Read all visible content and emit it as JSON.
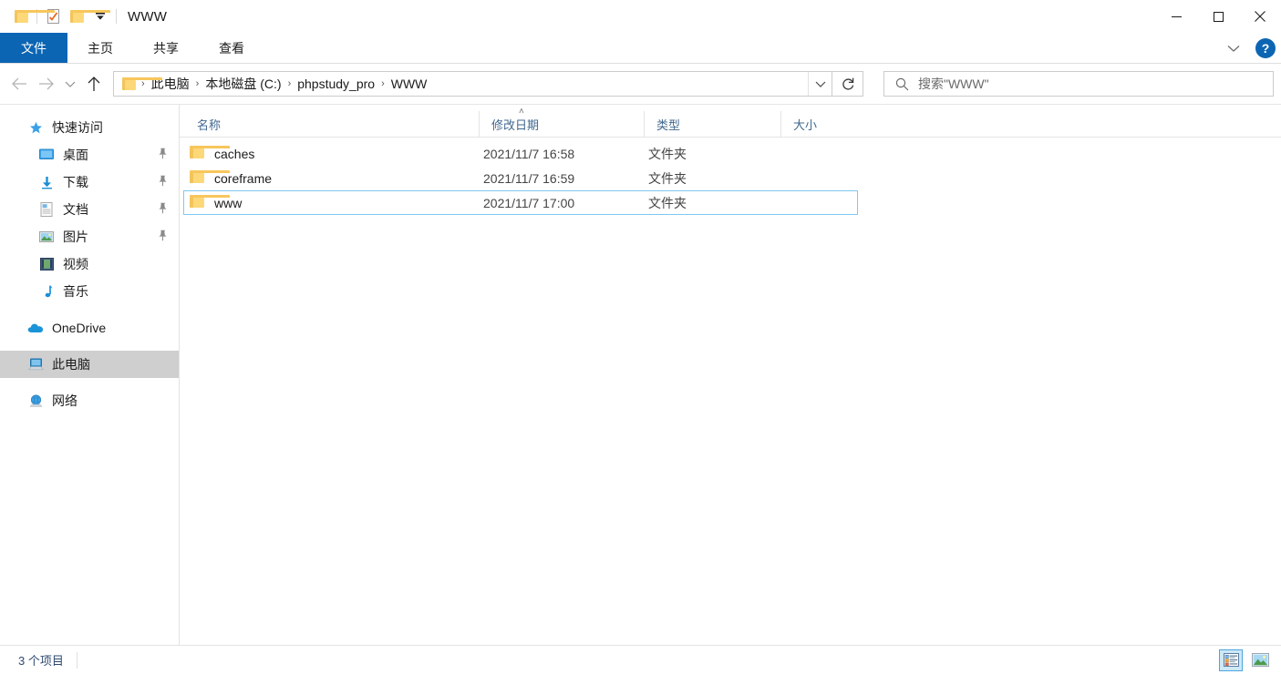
{
  "window": {
    "title": "WWW",
    "controls": {
      "minimize": "—",
      "maximize": "□",
      "close": "✕"
    }
  },
  "quick_access_toolbar": {
    "items": [
      {
        "name": "folder-icon",
        "label": ""
      },
      {
        "name": "properties-icon",
        "label": ""
      },
      {
        "name": "new-folder-icon",
        "label": ""
      },
      {
        "name": "customize-dropdown-icon",
        "label": "⯆"
      }
    ]
  },
  "ribbon": {
    "tabs": [
      {
        "label": "文件",
        "active": true
      },
      {
        "label": "主页",
        "active": false
      },
      {
        "label": "共享",
        "active": false
      },
      {
        "label": "查看",
        "active": false
      }
    ],
    "expand_icon": "⌄",
    "help_label": "?"
  },
  "navigation": {
    "back_icon": "←",
    "forward_icon": "→",
    "recent_icon": "⌄",
    "up_icon": "↑",
    "breadcrumbs": [
      "此电脑",
      "本地磁盘 (C:)",
      "phpstudy_pro",
      "WWW"
    ],
    "separator": "›",
    "dropdown_icon": "⌄",
    "refresh_icon": "↻"
  },
  "search": {
    "placeholder": "搜索\"WWW\"",
    "value": "",
    "icon": "search-icon"
  },
  "sidebar": {
    "items": [
      {
        "label": "快速访问",
        "icon": "star-icon",
        "level": 0,
        "pinned": false,
        "selected": false
      },
      {
        "label": "桌面",
        "icon": "desktop-icon",
        "level": 1,
        "pinned": true,
        "selected": false
      },
      {
        "label": "下载",
        "icon": "downloads-icon",
        "level": 1,
        "pinned": true,
        "selected": false
      },
      {
        "label": "文档",
        "icon": "documents-icon",
        "level": 1,
        "pinned": true,
        "selected": false
      },
      {
        "label": "图片",
        "icon": "pictures-icon",
        "level": 1,
        "pinned": true,
        "selected": false
      },
      {
        "label": "视频",
        "icon": "videos-icon",
        "level": 1,
        "pinned": false,
        "selected": false
      },
      {
        "label": "音乐",
        "icon": "music-icon",
        "level": 1,
        "pinned": false,
        "selected": false
      },
      {
        "label": "OneDrive",
        "icon": "cloud-icon",
        "level": 0,
        "pinned": false,
        "selected": false
      },
      {
        "label": "此电脑",
        "icon": "this-pc-icon",
        "level": 0,
        "pinned": false,
        "selected": true
      },
      {
        "label": "网络",
        "icon": "network-icon",
        "level": 0,
        "pinned": false,
        "selected": false
      }
    ],
    "pin_glyph": "📌"
  },
  "filelist": {
    "columns": [
      {
        "label": "名称",
        "key": "name"
      },
      {
        "label": "修改日期",
        "key": "date"
      },
      {
        "label": "类型",
        "key": "type"
      },
      {
        "label": "大小",
        "key": "size"
      }
    ],
    "sort_indicator": "˄",
    "rows": [
      {
        "name": "caches",
        "date": "2021/11/7 16:58",
        "type": "文件夹",
        "size": "",
        "selected": false
      },
      {
        "name": "coreframe",
        "date": "2021/11/7 16:59",
        "type": "文件夹",
        "size": "",
        "selected": false
      },
      {
        "name": "www",
        "date": "2021/11/7 17:00",
        "type": "文件夹",
        "size": "",
        "selected": true
      }
    ]
  },
  "statusbar": {
    "item_count": "3 个项目",
    "views": [
      {
        "name": "details-view-button",
        "active": true
      },
      {
        "name": "large-icons-view-button",
        "active": false
      }
    ]
  },
  "colors": {
    "accent_blue": "#0c65b3",
    "selection_border": "#7fc8f0",
    "sidebar_selected": "#cfcfcf",
    "column_header_text": "#41688f",
    "folder_yellow": "#fdd878"
  }
}
